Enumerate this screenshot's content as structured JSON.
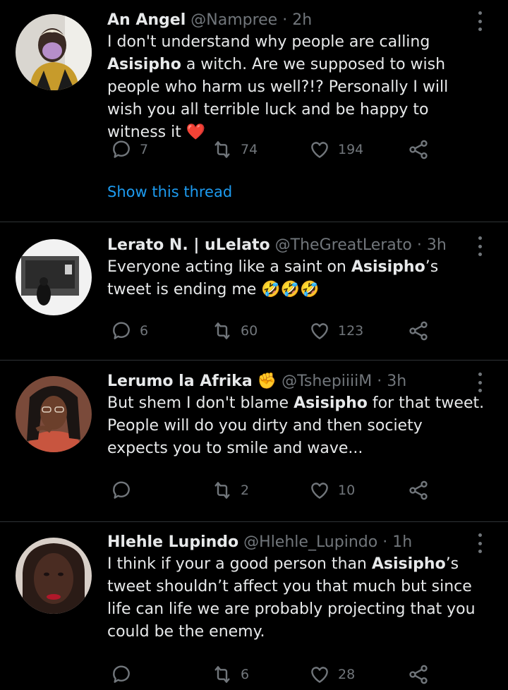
{
  "tweets": [
    {
      "name": "An Angel",
      "handle": "@Nampree",
      "dot": "·",
      "time": "2h",
      "text_pre": "I don't understand why people are calling ",
      "text_bold": "Asisipho",
      "text_post": " a witch. Are we supposed to wish people who harm us well?!? Personally I will wish you all terrible luck and be happy to witness it",
      "emoji": "❤️",
      "replies": "7",
      "retweets": "74",
      "likes": "194",
      "show_thread": "Show this thread"
    },
    {
      "name": "Lerato N. | uLelato",
      "handle": "@TheGreatLerato",
      "dot": "·",
      "time": "3h",
      "text_pre": "Everyone acting like a saint on ",
      "text_bold": "Asisipho",
      "text_post": "’s tweet is ending me",
      "emoji": "🤣🤣🤣",
      "replies": "6",
      "retweets": "60",
      "likes": "123"
    },
    {
      "name": "Lerumo la Afrika",
      "name_emoji": "✊",
      "handle": "@TshepiiiiM",
      "dot": "·",
      "time": "3h",
      "text_pre": "But shem I don't blame ",
      "text_bold": "Asisipho",
      "text_post": " for that tweet. People will do you dirty and then society expects you to smile and wave...",
      "replies": "",
      "retweets": "2",
      "likes": "10"
    },
    {
      "name": "Hlehle Lupindo",
      "handle": "@Hlehle_Lupindo",
      "dot": "·",
      "time": "1h",
      "text_pre": "I think if your a good person than ",
      "text_bold": "Asisipho",
      "text_post": "’s tweet shouldn’t affect you that much but since life can life we are probably projecting that you could be the enemy.",
      "replies": "",
      "retweets": "6",
      "likes": "28"
    }
  ],
  "colors": {
    "background": "#000000",
    "text": "#e7e9ea",
    "muted": "#71767b",
    "link": "#1d9bf0",
    "divider": "#2f3336"
  }
}
